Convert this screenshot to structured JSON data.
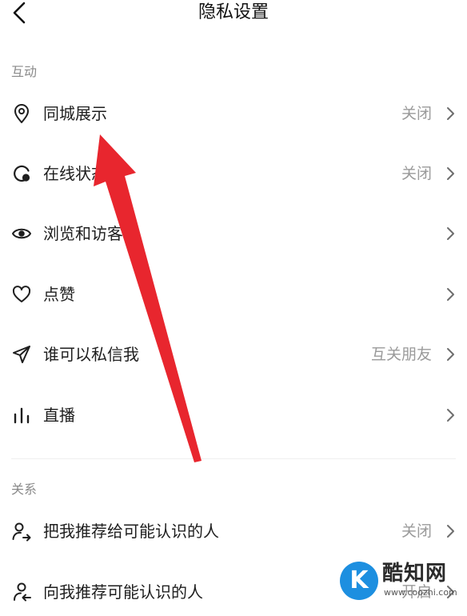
{
  "header": {
    "title": "隐私设置"
  },
  "sections": {
    "interaction": "互动",
    "relations": "关系"
  },
  "rows": [
    {
      "label": "同城展示",
      "value": "关闭",
      "icon": "location-pin-icon"
    },
    {
      "label": "在线状态",
      "value": "关闭",
      "icon": "online-status-icon"
    },
    {
      "label": "浏览和访客",
      "value": "",
      "icon": "eye-icon"
    },
    {
      "label": "点赞",
      "value": "",
      "icon": "heart-icon"
    },
    {
      "label": "谁可以私信我",
      "value": "互关朋友",
      "icon": "send-icon"
    },
    {
      "label": "直播",
      "value": "",
      "icon": "live-bars-icon"
    },
    {
      "label": "把我推荐给可能认识的人",
      "value": "关闭",
      "icon": "recommend-me-icon"
    },
    {
      "label": "向我推荐可能认识的人",
      "value": "开启",
      "icon": "recommend-to-me-icon"
    }
  ],
  "watermark": {
    "text": "酷知网",
    "url": "www.coozhi.com"
  },
  "colors": {
    "arrow": "#e8262e",
    "value_text": "#9a9a9a",
    "section_text": "#8a8a8a",
    "watermark_blue": "#1d8fe0"
  }
}
